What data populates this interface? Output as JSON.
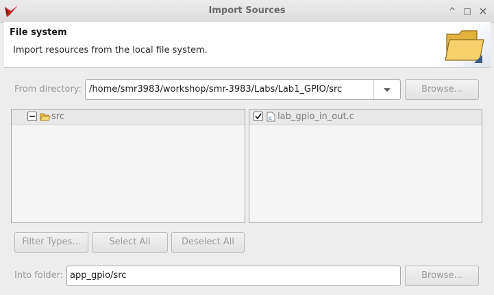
{
  "window": {
    "title": "Import Sources",
    "minimize_glyph": "^",
    "maximize_glyph": "□",
    "close_glyph": "×"
  },
  "banner": {
    "title": "File system",
    "description": "Import resources from the local file system.",
    "icon": "folder-icon"
  },
  "from_directory": {
    "label": "From directory:",
    "value": "/home/smr3983/workshop/smr-3983/Labs/Lab1_GPIO/src",
    "browse_label": "Browse..."
  },
  "folder_tree": {
    "items": [
      {
        "label": "src",
        "state": "partial",
        "icon": "folder-open-icon"
      }
    ]
  },
  "file_list": {
    "items": [
      {
        "label": "lab_gpio_in_out.c",
        "state": "checked",
        "icon": "c-file-icon"
      }
    ]
  },
  "actions": {
    "filter_types": "Filter Types...",
    "select_all": "Select All",
    "deselect_all": "Deselect All"
  },
  "into_folder": {
    "label": "Into folder:",
    "value": "app_gpio/src",
    "browse_label": "Browse..."
  },
  "colors": {
    "accent_red": "#cc1f1f",
    "folder_yellow": "#f2c04a"
  }
}
